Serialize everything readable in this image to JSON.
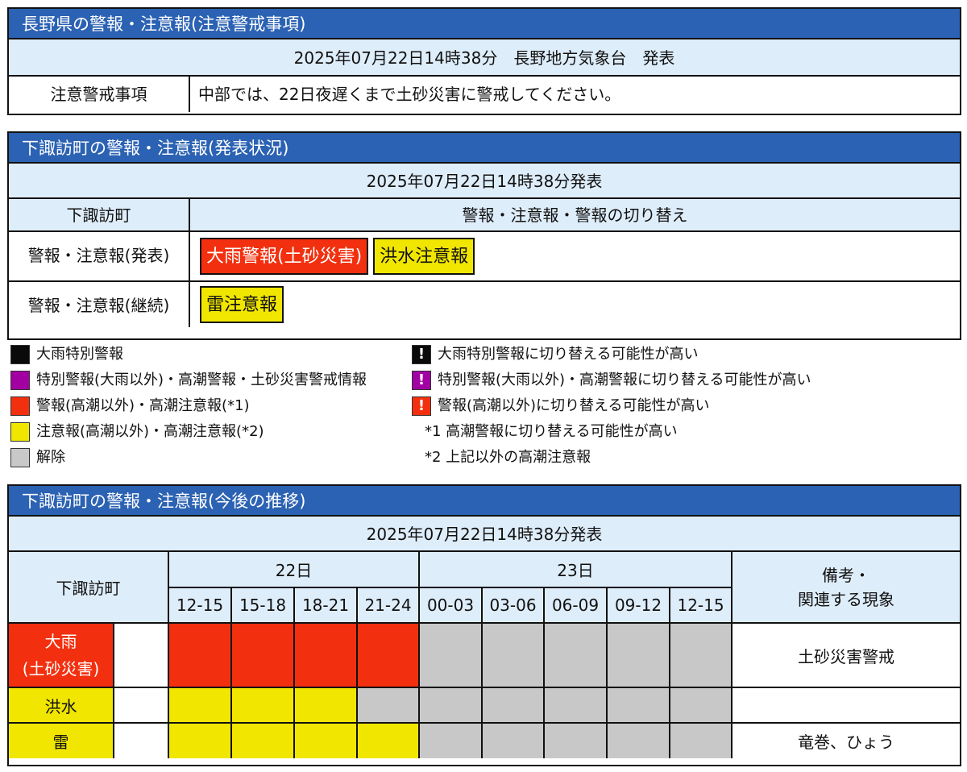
{
  "summary": {
    "title": "長野県の警報・注意報(注意警戒事項)",
    "issued": "2025年07月22日14時38分　長野地方気象台　発表",
    "caution_label": "注意警戒事項",
    "caution_text": "中部では、22日夜遅くまで土砂災害に警戒してください。"
  },
  "status": {
    "title": "下諏訪町の警報・注意報(発表状況)",
    "issued": "2025年07月22日14時38分発表",
    "col_area": "下諏訪町",
    "col_switch": "警報・注意報・警報の切り替え",
    "rows": [
      {
        "label": "警報・注意報(発表)",
        "tags": [
          {
            "text": "大雨警報(土砂災害)",
            "kind": "red"
          },
          {
            "text": "洪水注意報",
            "kind": "yellow"
          }
        ]
      },
      {
        "label": "警報・注意報(継続)",
        "tags": [
          {
            "text": "雷注意報",
            "kind": "yellow"
          }
        ]
      }
    ]
  },
  "legend": {
    "left": [
      {
        "color": "#0a0a0a",
        "text": "大雨特別警報"
      },
      {
        "color": "#a300a3",
        "text": "特別警報(大雨以外)・高潮警報・土砂災害警戒情報"
      },
      {
        "color": "#f2300f",
        "text": "警報(高潮以外)・高潮注意報(*1)"
      },
      {
        "color": "#f1e600",
        "text": "注意報(高潮以外)・高潮注意報(*2)"
      },
      {
        "color": "#c8c8c8",
        "text": "解除"
      }
    ],
    "right": [
      {
        "color": "#0a0a0a",
        "mark": "!",
        "text": "大雨特別警報に切り替える可能性が高い"
      },
      {
        "color": "#a300a3",
        "mark": "!",
        "text": "特別警報(大雨以外)・高潮警報に切り替える可能性が高い"
      },
      {
        "color": "#f2300f",
        "mark": "!",
        "text": "警報(高潮以外)に切り替える可能性が高い"
      }
    ],
    "notes": [
      "*1 高潮警報に切り替える可能性が高い",
      "*2 上記以外の高潮注意報"
    ]
  },
  "timeline": {
    "title": "下諏訪町の警報・注意報(今後の推移)",
    "issued": "2025年07月22日14時38分発表",
    "area": "下諏訪町",
    "days": [
      {
        "label": "22日",
        "span": 4
      },
      {
        "label": "23日",
        "span": 5
      }
    ],
    "slots": [
      "12-15",
      "15-18",
      "18-21",
      "21-24",
      "00-03",
      "03-06",
      "06-09",
      "09-12",
      "12-15"
    ],
    "remarks_header": "備考・\n関連する現象",
    "rows": [
      {
        "name_line1": "大雨",
        "name_line2": "(土砂災害)",
        "kind": "red",
        "cells": [
          "red",
          "red",
          "red",
          "red",
          "gray",
          "gray",
          "gray",
          "gray",
          "gray"
        ],
        "remark": "土砂災害警戒"
      },
      {
        "name_line1": "洪水",
        "name_line2": "",
        "kind": "yellow",
        "cells": [
          "yellow",
          "yellow",
          "yellow",
          "gray",
          "gray",
          "gray",
          "gray",
          "gray",
          "gray"
        ],
        "remark": ""
      },
      {
        "name_line1": "雷",
        "name_line2": "",
        "kind": "yellow",
        "cells": [
          "yellow",
          "yellow",
          "yellow",
          "yellow",
          "gray",
          "gray",
          "gray",
          "gray",
          "gray"
        ],
        "remark": "竜巻、ひょう"
      }
    ]
  }
}
